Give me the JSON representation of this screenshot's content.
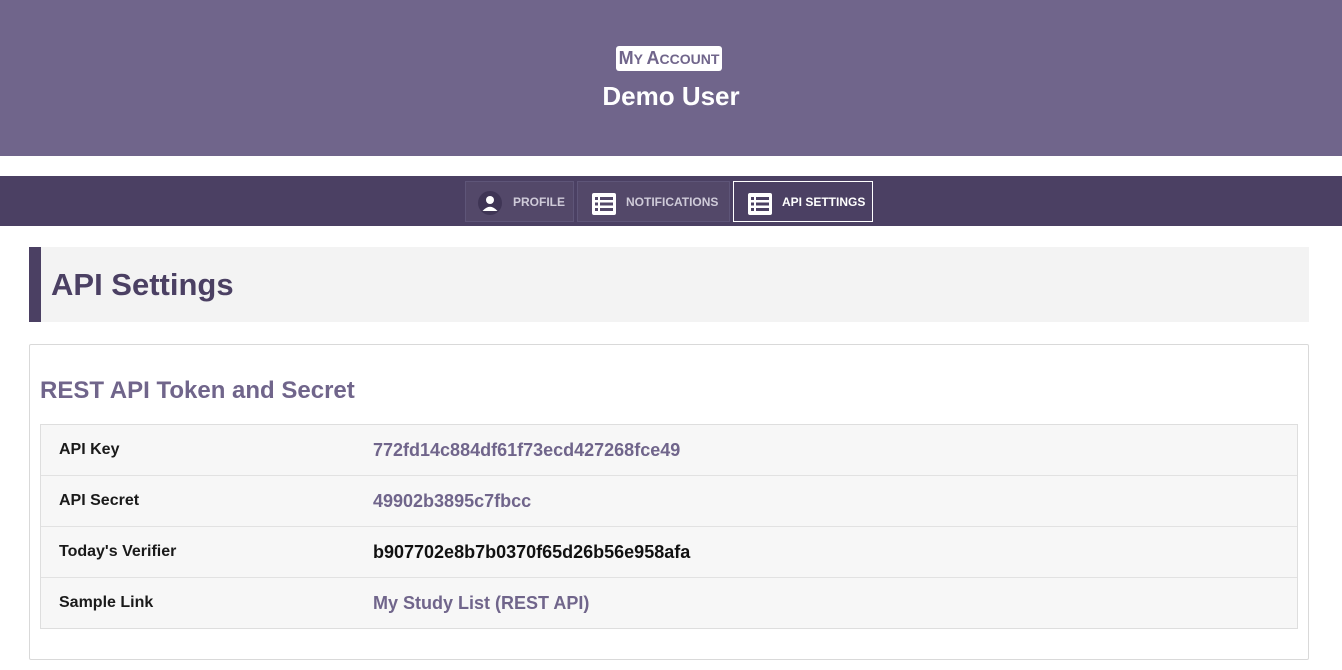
{
  "header": {
    "badge": "My Account",
    "badge_first": "M",
    "badge_rest1": "Y ",
    "badge_second": "A",
    "badge_rest2": "CCOUNT",
    "user_name": "Demo User"
  },
  "tabs": [
    {
      "label": "PROFILE",
      "icon": "user-icon",
      "active": false
    },
    {
      "label": "NOTIFICATIONS",
      "icon": "list-icon",
      "active": false
    },
    {
      "label": "API SETTINGS",
      "icon": "list-icon",
      "active": true
    }
  ],
  "page": {
    "title": "API Settings"
  },
  "panel": {
    "heading": "REST API Token and Secret",
    "rows": [
      {
        "key": "API Key",
        "value": "772fd14c884df61f73ecd427268fce49",
        "is_link": true
      },
      {
        "key": "API Secret",
        "value": "49902b3895c7fbcc",
        "is_link": true
      },
      {
        "key": "Today's Verifier",
        "value": "b907702e8b7b0370f65d26b56e958afa",
        "is_link": false
      },
      {
        "key": "Sample Link",
        "value": "My Study List (REST API)",
        "is_link": true
      }
    ]
  },
  "colors": {
    "header_bg": "#70658b",
    "tabbar_bg": "#4b4063",
    "accent": "#4b4063",
    "link": "#70658b"
  }
}
